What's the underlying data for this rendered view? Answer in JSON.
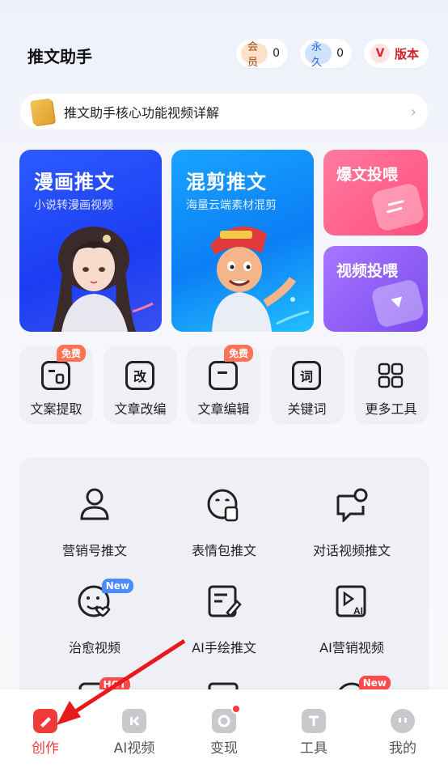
{
  "header": {
    "title": "推文助手",
    "member": {
      "label": "会员",
      "count": "0"
    },
    "permanent": {
      "label": "永久",
      "count": "0"
    },
    "version": {
      "badge": "V",
      "label": "版本"
    }
  },
  "banner": {
    "text": "推文助手核心功能视频详解"
  },
  "feature_cards": {
    "comic": {
      "title": "漫画推文",
      "subtitle": "小说转漫画视频"
    },
    "mix": {
      "title": "混剪推文",
      "subtitle": "海量云端素材混剪"
    },
    "hot": {
      "title": "爆文投喂"
    },
    "video": {
      "title": "视频投喂"
    }
  },
  "tools": [
    {
      "label": "文案提取",
      "badge": "免费",
      "icon": "document-icon"
    },
    {
      "label": "文章改编",
      "glyph": "改",
      "icon": "edit-char-icon"
    },
    {
      "label": "文章编辑",
      "badge": "免费",
      "icon": "article-icon"
    },
    {
      "label": "关键词",
      "glyph": "词",
      "icon": "keyword-icon"
    },
    {
      "label": "更多工具",
      "icon": "grid-icon"
    }
  ],
  "grid": [
    {
      "label": "营销号推文",
      "icon": "person-icon"
    },
    {
      "label": "表情包推文",
      "icon": "sticker-icon"
    },
    {
      "label": "对话视频推文",
      "icon": "chat-icon"
    },
    {
      "label": "治愈视频",
      "badge": "New",
      "icon": "smile-heart-icon"
    },
    {
      "label": "AI手绘推文",
      "icon": "draw-icon"
    },
    {
      "label": "AI营销视频",
      "icon": "ai-video-icon"
    }
  ],
  "grid_partial_badges": {
    "hot": "HOT",
    "new": "New"
  },
  "nav": {
    "items": [
      {
        "label": "创作",
        "active": true
      },
      {
        "label": "AI视频"
      },
      {
        "label": "变现"
      },
      {
        "label": "工具"
      },
      {
        "label": "我的"
      }
    ]
  },
  "colors": {
    "accent": "#f23a3a",
    "comic_card": "#1a3df2",
    "mix_card": "#0b7ef5",
    "hot_card": "#ff4f7c",
    "video_card": "#7b4bef"
  }
}
